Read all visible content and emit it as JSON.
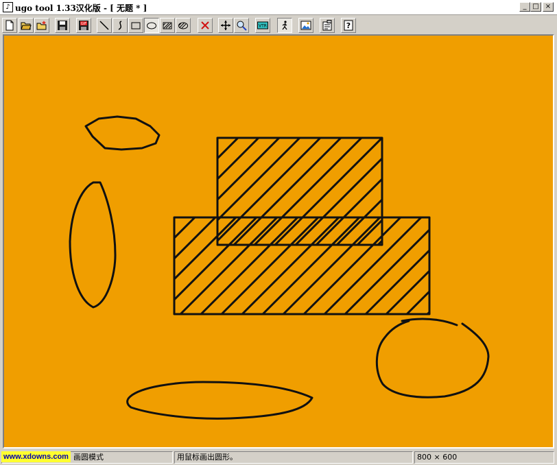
{
  "window": {
    "title": "ugo tool 1.33汉化版 - [ 无题 * ]",
    "icon": "app-page-icon",
    "controls": [
      "minimize",
      "maximize",
      "close"
    ]
  },
  "toolbar": {
    "buttons": [
      {
        "name": "new-file-button",
        "icon": "new-page-icon"
      },
      {
        "name": "open-file-button",
        "icon": "folder-open-icon"
      },
      {
        "name": "open-recent-button",
        "icon": "folder-star-icon"
      },
      {
        "name": "save-button",
        "icon": "floppy-icon"
      },
      {
        "name": "save-gif-button",
        "icon": "floppy-gif-icon",
        "label": "GIF"
      },
      {
        "name": "line-tool-button",
        "icon": "line-icon"
      },
      {
        "name": "curve-tool-button",
        "icon": "curve-icon"
      },
      {
        "name": "rectangle-tool-button",
        "icon": "rectangle-icon"
      },
      {
        "name": "ellipse-tool-button",
        "icon": "ellipse-icon",
        "pressed": true
      },
      {
        "name": "hatched-rect-tool-button",
        "icon": "hatched-rectangle-icon"
      },
      {
        "name": "hatched-ellipse-tool-button",
        "icon": "hatched-ellipse-icon"
      },
      {
        "name": "delete-button",
        "icon": "red-x-icon"
      },
      {
        "name": "move-button",
        "icon": "move-arrows-icon"
      },
      {
        "name": "zoom-button",
        "icon": "magnifier-icon"
      },
      {
        "name": "vtr-button",
        "icon": "vtr-icon",
        "label": "VTR"
      },
      {
        "name": "animation-button",
        "icon": "walking-figure-icon"
      },
      {
        "name": "image-button",
        "icon": "picture-icon"
      },
      {
        "name": "properties-button",
        "icon": "properties-icon"
      },
      {
        "name": "help-button",
        "icon": "help-icon",
        "label": "?"
      }
    ]
  },
  "canvas": {
    "background_color": "#f09e00",
    "stroke_color": "#111111"
  },
  "statusbar": {
    "watermark": "www.xdowns.com",
    "mode": "画圆模式",
    "hint": "用鼠标画出圆形。",
    "size": "800 × 600"
  }
}
